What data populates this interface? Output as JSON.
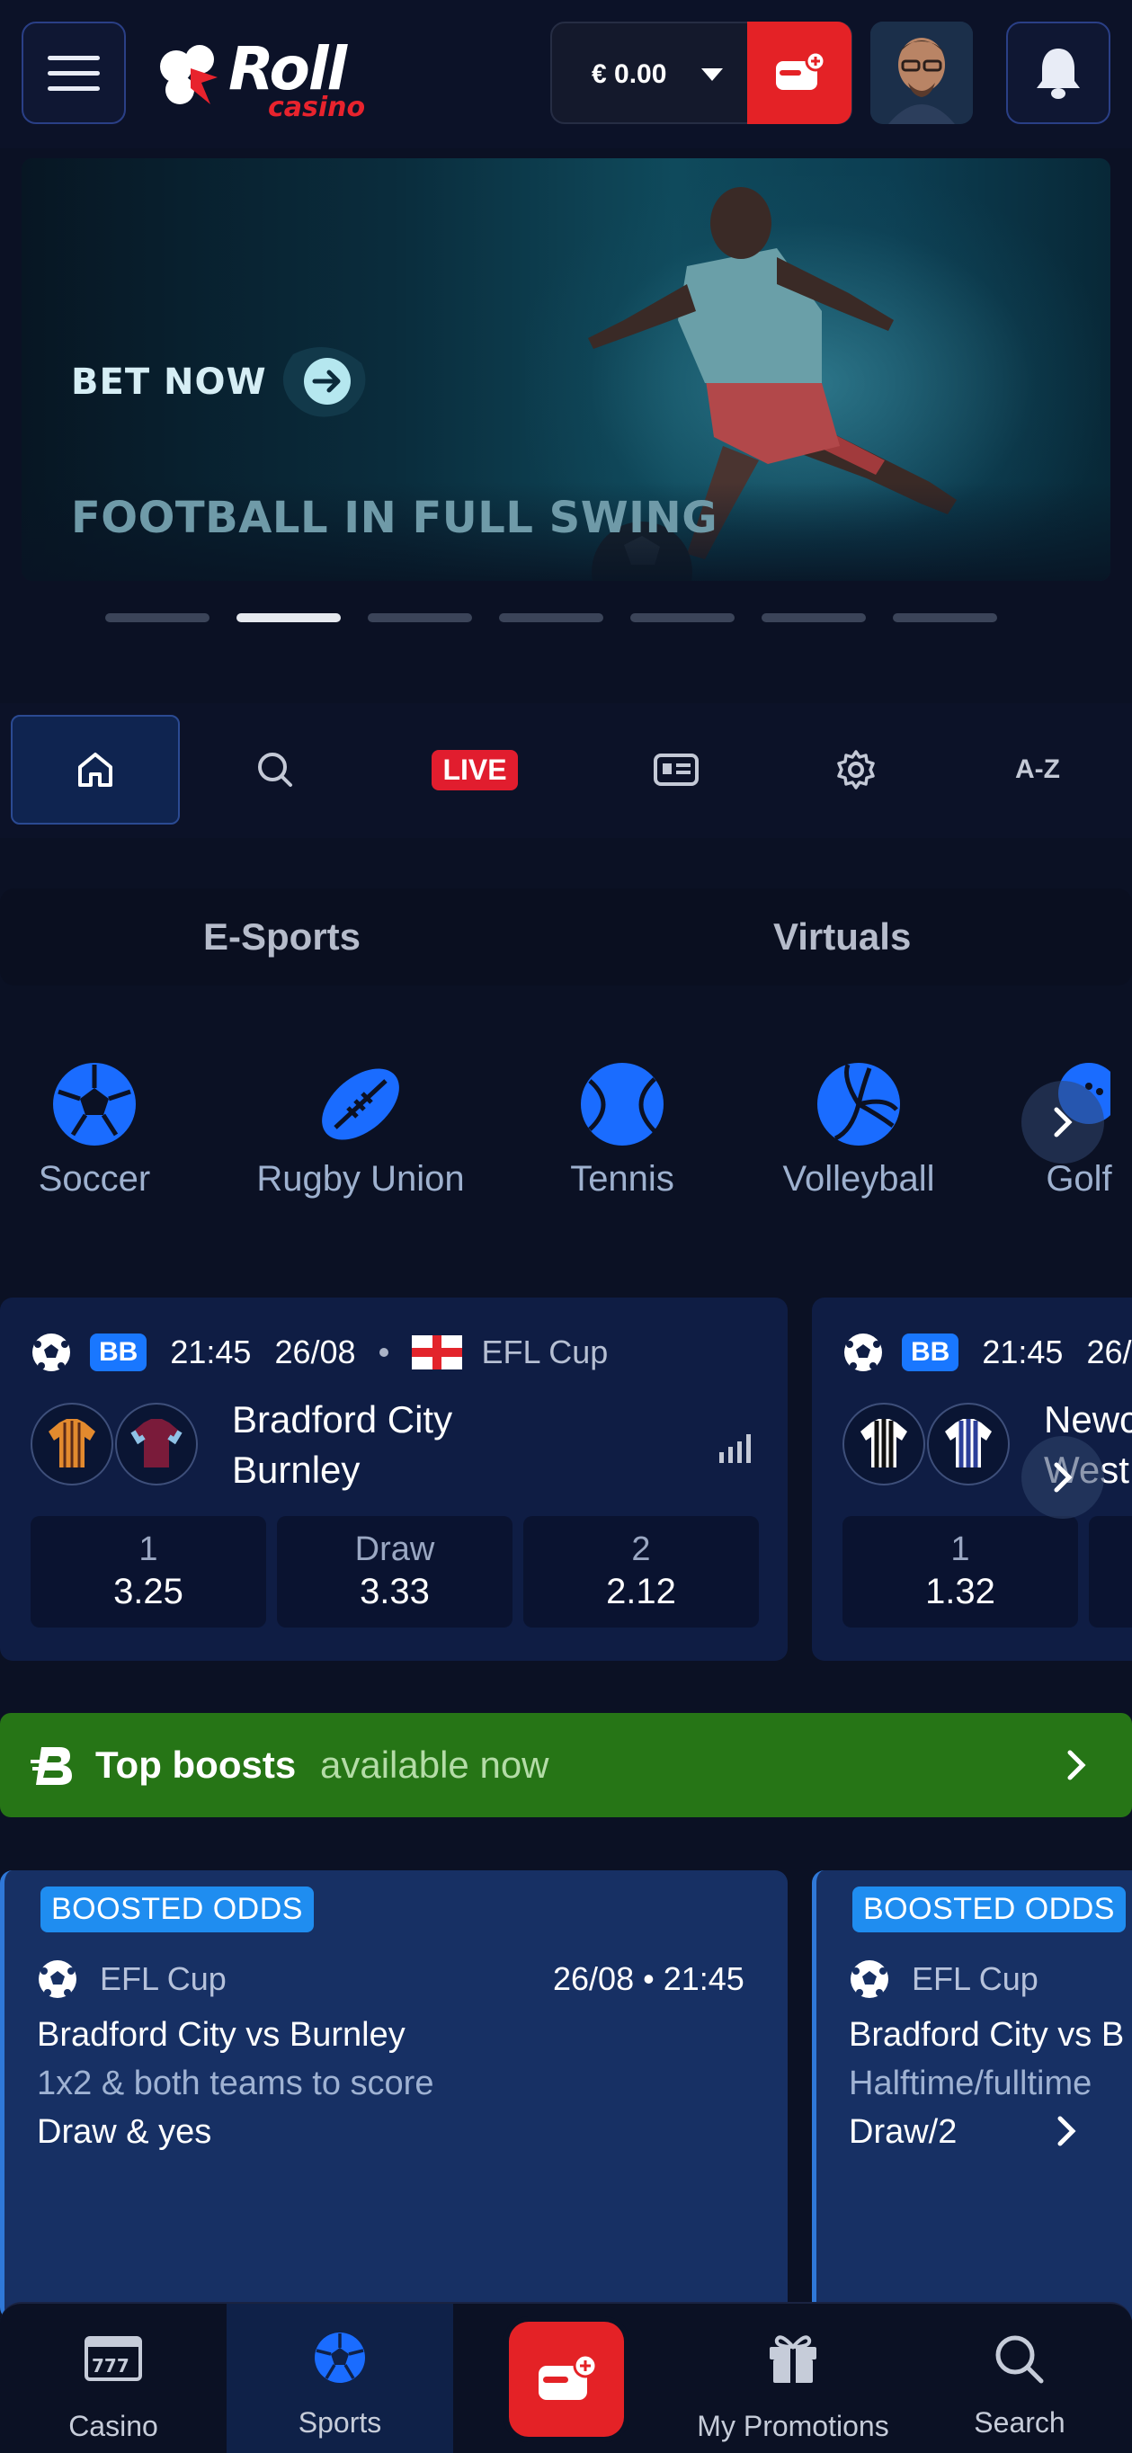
{
  "header": {
    "brand": "Roll",
    "brand_sub": "casino",
    "balance": "€ 0.00"
  },
  "hero": {
    "cta": "BET NOW",
    "headline": "FOOTBALL IN FULL SWING",
    "slides_total": 7,
    "active_slide": 2
  },
  "quick_nav": {
    "live": "LIVE",
    "az": "A-Z"
  },
  "segments": {
    "esports": "E-Sports",
    "virtuals": "Virtuals"
  },
  "sports": [
    {
      "label": "Soccer",
      "icon": "soccer-ball-icon"
    },
    {
      "label": "Rugby Union",
      "icon": "rugby-ball-icon"
    },
    {
      "label": "Tennis",
      "icon": "tennis-ball-icon"
    },
    {
      "label": "Volleyball",
      "icon": "volleyball-icon"
    },
    {
      "label": "Golf",
      "icon": "golf-icon"
    }
  ],
  "matches": [
    {
      "badge": "BB",
      "time": "21:45",
      "date": "26/08",
      "competition": "EFL Cup",
      "home": "Bradford City",
      "away": "Burnley",
      "odds": [
        {
          "label": "1",
          "value": "3.25"
        },
        {
          "label": "Draw",
          "value": "3.33"
        },
        {
          "label": "2",
          "value": "2.12"
        }
      ]
    },
    {
      "badge": "BB",
      "time": "21:45",
      "date": "26/",
      "competition": "",
      "home": "Newc",
      "away": "West",
      "odds": [
        {
          "label": "1",
          "value": "1.32"
        }
      ]
    }
  ],
  "boosts": {
    "title": "Top boosts",
    "subtitle": "available now"
  },
  "boost_cards": [
    {
      "badge": "BOOSTED ODDS",
      "competition": "EFL Cup",
      "datetime": "26/08 • 21:45",
      "match": "Bradford City vs Burnley",
      "market": "1x2 & both teams to score",
      "selection": "Draw & yes"
    },
    {
      "badge": "BOOSTED ODDS",
      "competition": "EFL Cup",
      "datetime": "",
      "match": "Bradford City vs B",
      "market": "Halftime/fulltime",
      "selection": "Draw/2"
    }
  ],
  "bottom_nav": {
    "casino": "Casino",
    "sports": "Sports",
    "promotions": "My Promotions",
    "search": "Search"
  },
  "colors": {
    "background": "#0b1124",
    "accent_red": "#e42226",
    "accent_blue": "#1977ff",
    "boost_green": "#267516",
    "card_navy": "#0f1d44"
  }
}
